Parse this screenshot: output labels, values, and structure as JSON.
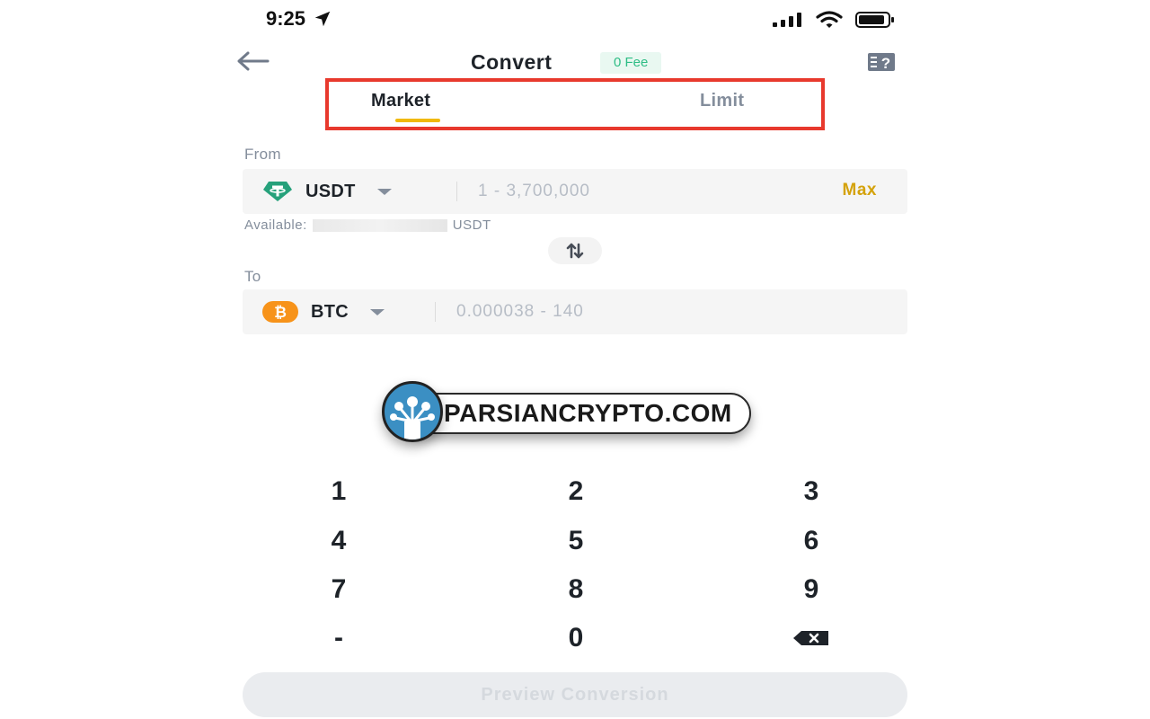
{
  "status_bar": {
    "time": "9:25"
  },
  "header": {
    "title": "Convert",
    "fee_badge": "0 Fee"
  },
  "tabs": [
    {
      "label": "Market",
      "active": true
    },
    {
      "label": "Limit",
      "active": false
    }
  ],
  "from": {
    "label": "From",
    "coin": "USDT",
    "placeholder": "1 - 3,700,000",
    "max_label": "Max",
    "available_label": "Available:",
    "available_unit": "USDT"
  },
  "to": {
    "label": "To",
    "coin": "BTC",
    "placeholder": "0.000038 - 140"
  },
  "watermark": {
    "text": "PARSIANCRYPTO.COM"
  },
  "keypad": {
    "keys": [
      "1",
      "2",
      "3",
      "4",
      "5",
      "6",
      "7",
      "8",
      "9",
      "-",
      "0",
      "backspace"
    ]
  },
  "preview_button": "Preview Conversion",
  "colors": {
    "accent": "#f0b90b",
    "max": "#d4a20b",
    "fee_green": "#2ebd85",
    "tether": "#26a17b",
    "bitcoin": "#f7931a",
    "highlight_frame": "#e8392d"
  },
  "icons": {
    "back": "arrow-left-icon",
    "help": "help-icon",
    "swap": "swap-arrows-icon",
    "backspace": "backspace-icon",
    "location": "location-arrow-icon",
    "signal": "signal-icon",
    "wifi": "wifi-icon",
    "battery": "battery-icon"
  }
}
